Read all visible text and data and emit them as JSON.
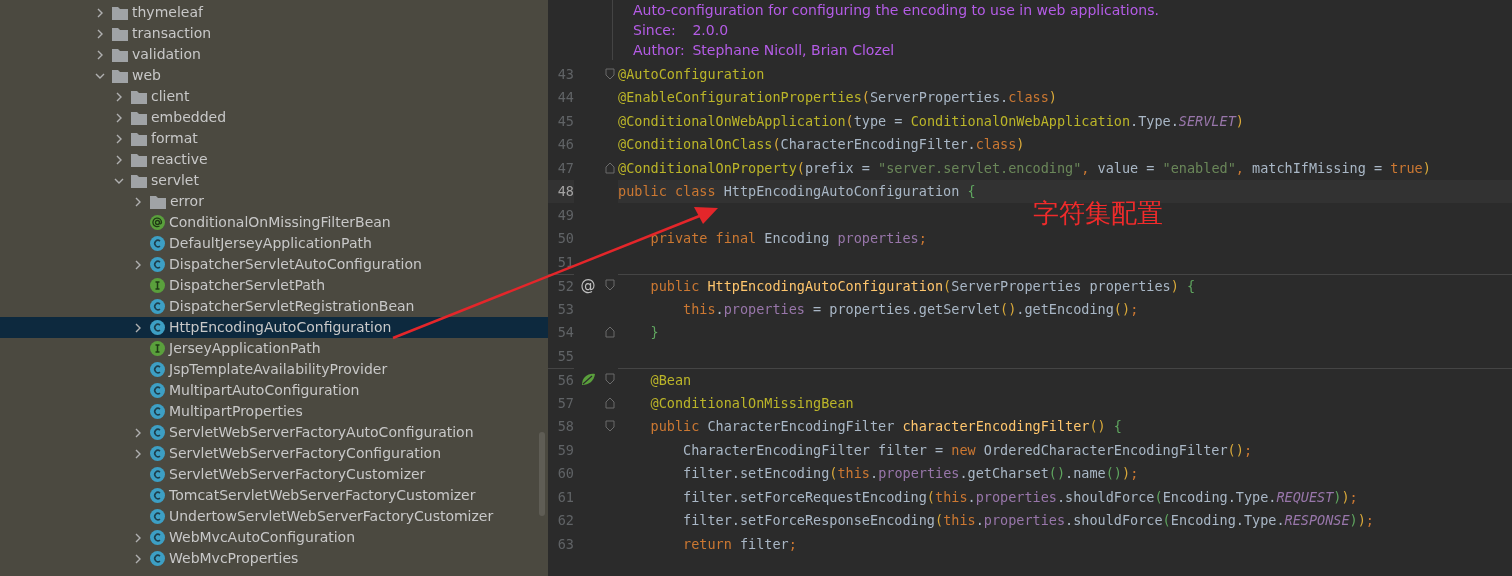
{
  "project_tree": {
    "items": [
      {
        "label": "thymeleaf",
        "kind": "folder",
        "expanded": false,
        "selected": false
      },
      {
        "label": "transaction",
        "kind": "folder",
        "expanded": false,
        "selected": false
      },
      {
        "label": "validation",
        "kind": "folder",
        "expanded": false,
        "selected": false
      },
      {
        "label": "web",
        "kind": "folder",
        "expanded": true,
        "selected": false,
        "children": [
          {
            "label": "client",
            "kind": "folder",
            "expanded": false,
            "selected": false
          },
          {
            "label": "embedded",
            "kind": "folder",
            "expanded": false,
            "selected": false
          },
          {
            "label": "format",
            "kind": "folder",
            "expanded": false,
            "selected": false
          },
          {
            "label": "reactive",
            "kind": "folder",
            "expanded": false,
            "selected": false
          },
          {
            "label": "servlet",
            "kind": "folder",
            "expanded": true,
            "selected": false,
            "children": [
              {
                "label": "error",
                "kind": "folder",
                "expanded": false,
                "selected": false
              },
              {
                "label": "ConditionalOnMissingFilterBean",
                "kind": "annotation",
                "selected": false
              },
              {
                "label": "DefaultJerseyApplicationPath",
                "kind": "class",
                "selected": false
              },
              {
                "label": "DispatcherServletAutoConfiguration",
                "kind": "class",
                "expanded": false,
                "selected": false
              },
              {
                "label": "DispatcherServletPath",
                "kind": "interface",
                "selected": false
              },
              {
                "label": "DispatcherServletRegistrationBean",
                "kind": "class",
                "selected": false
              },
              {
                "label": "HttpEncodingAutoConfiguration",
                "kind": "class",
                "expanded": false,
                "selected": true
              },
              {
                "label": "JerseyApplicationPath",
                "kind": "interface",
                "selected": false
              },
              {
                "label": "JspTemplateAvailabilityProvider",
                "kind": "class",
                "selected": false
              },
              {
                "label": "MultipartAutoConfiguration",
                "kind": "class",
                "selected": false
              },
              {
                "label": "MultipartProperties",
                "kind": "class",
                "selected": false
              },
              {
                "label": "ServletWebServerFactoryAutoConfiguration",
                "kind": "class",
                "expanded": false,
                "selected": false
              },
              {
                "label": "ServletWebServerFactoryConfiguration",
                "kind": "class",
                "expanded": false,
                "selected": false
              },
              {
                "label": "ServletWebServerFactoryCustomizer",
                "kind": "class",
                "selected": false
              },
              {
                "label": "TomcatServletWebServerFactoryCustomizer",
                "kind": "class",
                "selected": false
              },
              {
                "label": "UndertowServletWebServerFactoryCustomizer",
                "kind": "class",
                "selected": false
              },
              {
                "label": "WebMvcAutoConfiguration",
                "kind": "class",
                "expanded": false,
                "selected": false
              },
              {
                "label": "WebMvcProperties",
                "kind": "class",
                "expanded": false,
                "selected": false
              }
            ]
          }
        ]
      }
    ]
  },
  "editor": {
    "javadoc": [
      {
        "text": "Auto-configuration for configuring the encoding to use in web applications."
      },
      {
        "tag": "Since:",
        "text": "2.0.0"
      },
      {
        "tag": "Author:",
        "text": "Stephane Nicoll, Brian Clozel"
      }
    ],
    "lines": [
      {
        "number": "43",
        "current": false,
        "separator_above": false,
        "fold_marker": {
          "kind": "start"
        },
        "tokens": [
          {
            "kind": "ann",
            "text": "@AutoConfiguration"
          }
        ]
      },
      {
        "number": "44",
        "current": false,
        "separator_above": false,
        "tokens": [
          {
            "kind": "ann",
            "text": "@EnableConfigurationProperties"
          },
          {
            "kind": "b1",
            "text": "("
          },
          {
            "kind": "plain",
            "text": "ServerProperties."
          },
          {
            "kind": "kw",
            "text": "class"
          },
          {
            "kind": "b1",
            "text": ")"
          }
        ]
      },
      {
        "number": "45",
        "current": false,
        "separator_above": false,
        "tokens": [
          {
            "kind": "ann",
            "text": "@ConditionalOnWebApplication"
          },
          {
            "kind": "b1",
            "text": "("
          },
          {
            "kind": "plain",
            "text": "type = "
          },
          {
            "kind": "ann",
            "text": "ConditionalOnWebApplication"
          },
          {
            "kind": "plain",
            "text": ".Type."
          },
          {
            "kind": "const",
            "text": "SERVLET"
          },
          {
            "kind": "b1",
            "text": ")"
          }
        ]
      },
      {
        "number": "46",
        "current": false,
        "separator_above": false,
        "tokens": [
          {
            "kind": "ann",
            "text": "@ConditionalOnClass"
          },
          {
            "kind": "b1",
            "text": "("
          },
          {
            "kind": "plain",
            "text": "CharacterEncodingFilter."
          },
          {
            "kind": "kw",
            "text": "class"
          },
          {
            "kind": "b1",
            "text": ")"
          }
        ]
      },
      {
        "number": "47",
        "current": false,
        "separator_above": false,
        "fold_marker": {
          "kind": "end"
        },
        "tokens": [
          {
            "kind": "ann",
            "text": "@ConditionalOnProperty"
          },
          {
            "kind": "b1",
            "text": "("
          },
          {
            "kind": "plain",
            "text": "prefix = "
          },
          {
            "kind": "str",
            "text": "\"server.servlet.encoding\""
          },
          {
            "kind": "kw",
            "text": ", "
          },
          {
            "kind": "plain",
            "text": "value = "
          },
          {
            "kind": "str",
            "text": "\"enabled\""
          },
          {
            "kind": "kw",
            "text": ", "
          },
          {
            "kind": "plain",
            "text": "matchIfMissing = "
          },
          {
            "kind": "kw",
            "text": "true"
          },
          {
            "kind": "b1",
            "text": ")"
          }
        ]
      },
      {
        "number": "48",
        "current": true,
        "separator_above": false,
        "tokens": [
          {
            "kind": "kw",
            "text": "public class "
          },
          {
            "kind": "plain",
            "text": "HttpEncodingAutoConfiguration "
          },
          {
            "kind": "b2",
            "text": "{"
          }
        ]
      },
      {
        "number": "49",
        "current": false,
        "separator_above": false
      },
      {
        "number": "50",
        "current": false,
        "separator_above": false,
        "tokens": [
          {
            "kind": "kw",
            "text": "    private final "
          },
          {
            "kind": "plain",
            "text": "Encoding "
          },
          {
            "kind": "field",
            "text": "properties"
          },
          {
            "kind": "kw",
            "text": ";"
          }
        ]
      },
      {
        "number": "51",
        "current": false,
        "separator_above": false
      },
      {
        "number": "52",
        "current": false,
        "separator_above": true,
        "gutter": {
          "kind": "at",
          "text": "@"
        },
        "fold_marker": {
          "kind": "start"
        },
        "tokens": [
          {
            "kind": "kw",
            "text": "    public "
          },
          {
            "kind": "fn",
            "text": "HttpEncodingAutoConfiguration"
          },
          {
            "kind": "b1",
            "text": "("
          },
          {
            "kind": "plain",
            "text": "ServerProperties properties"
          },
          {
            "kind": "b1",
            "text": ")"
          },
          {
            "kind": "b2",
            "text": " {"
          }
        ]
      },
      {
        "number": "53",
        "current": false,
        "separator_above": false,
        "tokens": [
          {
            "kind": "kw",
            "text": "        this"
          },
          {
            "kind": "plain",
            "text": "."
          },
          {
            "kind": "field",
            "text": "properties"
          },
          {
            "kind": "plain",
            "text": " = properties.getServlet"
          },
          {
            "kind": "b1",
            "text": "()"
          },
          {
            "kind": "plain",
            "text": ".getEncoding"
          },
          {
            "kind": "b1",
            "text": "()"
          },
          {
            "kind": "kw",
            "text": ";"
          }
        ]
      },
      {
        "number": "54",
        "current": false,
        "separator_above": false,
        "fold_marker": {
          "kind": "end"
        },
        "tokens": [
          {
            "kind": "b2",
            "text": "    }"
          }
        ]
      },
      {
        "number": "55",
        "current": false,
        "separator_above": false
      },
      {
        "number": "56",
        "current": false,
        "separator_above": true,
        "gutter": {
          "kind": "bean"
        },
        "fold_marker": {
          "kind": "start"
        },
        "tokens": [
          {
            "kind": "ann",
            "text": "    @Bean"
          }
        ]
      },
      {
        "number": "57",
        "current": false,
        "separator_above": false,
        "fold_marker": {
          "kind": "end"
        },
        "tokens": [
          {
            "kind": "ann",
            "text": "    @ConditionalOnMissingBean"
          }
        ]
      },
      {
        "number": "58",
        "current": false,
        "separator_above": false,
        "fold_marker": {
          "kind": "start"
        },
        "tokens": [
          {
            "kind": "kw",
            "text": "    public "
          },
          {
            "kind": "plain",
            "text": "CharacterEncodingFilter "
          },
          {
            "kind": "fn",
            "text": "characterEncodingFilter"
          },
          {
            "kind": "b1",
            "text": "()"
          },
          {
            "kind": "b2",
            "text": " {"
          }
        ]
      },
      {
        "number": "59",
        "current": false,
        "separator_above": false,
        "tokens": [
          {
            "kind": "plain",
            "text": "        CharacterEncodingFilter filter = "
          },
          {
            "kind": "kw",
            "text": "new "
          },
          {
            "kind": "plain",
            "text": "OrderedCharacterEncodingFilter"
          },
          {
            "kind": "b1",
            "text": "()"
          },
          {
            "kind": "kw",
            "text": ";"
          }
        ]
      },
      {
        "number": "60",
        "current": false,
        "separator_above": false,
        "tokens": [
          {
            "kind": "plain",
            "text": "        filter.setEncoding"
          },
          {
            "kind": "b1",
            "text": "("
          },
          {
            "kind": "kw",
            "text": "this"
          },
          {
            "kind": "plain",
            "text": "."
          },
          {
            "kind": "field",
            "text": "properties"
          },
          {
            "kind": "plain",
            "text": ".getCharset"
          },
          {
            "kind": "b2",
            "text": "()"
          },
          {
            "kind": "plain",
            "text": ".name"
          },
          {
            "kind": "b2",
            "text": "()"
          },
          {
            "kind": "b1",
            "text": ")"
          },
          {
            "kind": "kw",
            "text": ";"
          }
        ]
      },
      {
        "number": "61",
        "current": false,
        "separator_above": false,
        "tokens": [
          {
            "kind": "plain",
            "text": "        filter.setForceRequestEncoding"
          },
          {
            "kind": "b1",
            "text": "("
          },
          {
            "kind": "kw",
            "text": "this"
          },
          {
            "kind": "plain",
            "text": "."
          },
          {
            "kind": "field",
            "text": "properties"
          },
          {
            "kind": "plain",
            "text": ".shouldForce"
          },
          {
            "kind": "b2",
            "text": "("
          },
          {
            "kind": "plain",
            "text": "Encoding.Type."
          },
          {
            "kind": "const",
            "text": "REQUEST"
          },
          {
            "kind": "b2",
            "text": ")"
          },
          {
            "kind": "b1",
            "text": ")"
          },
          {
            "kind": "kw",
            "text": ";"
          }
        ]
      },
      {
        "number": "62",
        "current": false,
        "separator_above": false,
        "tokens": [
          {
            "kind": "plain",
            "text": "        filter.setForceResponseEncoding"
          },
          {
            "kind": "b1",
            "text": "("
          },
          {
            "kind": "kw",
            "text": "this"
          },
          {
            "kind": "plain",
            "text": "."
          },
          {
            "kind": "field",
            "text": "properties"
          },
          {
            "kind": "plain",
            "text": ".shouldForce"
          },
          {
            "kind": "b2",
            "text": "("
          },
          {
            "kind": "plain",
            "text": "Encoding.Type."
          },
          {
            "kind": "const",
            "text": "RESPONSE"
          },
          {
            "kind": "b2",
            "text": ")"
          },
          {
            "kind": "b1",
            "text": ")"
          },
          {
            "kind": "kw",
            "text": ";"
          }
        ]
      },
      {
        "number": "63",
        "current": false,
        "separator_above": false,
        "tokens": [
          {
            "kind": "kw",
            "text": "        return "
          },
          {
            "kind": "plain",
            "text": "filter"
          },
          {
            "kind": "kw",
            "text": ";"
          }
        ]
      }
    ]
  },
  "annotation": {
    "label": "字符集配置"
  }
}
